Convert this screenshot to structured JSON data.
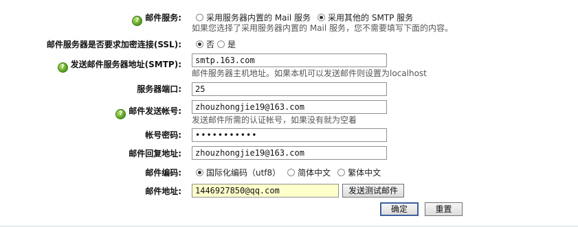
{
  "mail_service": {
    "label": "邮件服务:",
    "options": [
      "采用服务器内置的 Mail 服务",
      "采用其他的 SMTP 服务"
    ],
    "hint": "如果您选择了采用服务器内置的 Mail 服务，您不需要填写下面的内容。"
  },
  "ssl": {
    "label": "邮件服务器是否要求加密连接(SSL):",
    "options": [
      "否",
      "是"
    ]
  },
  "smtp_host": {
    "label": "发送邮件服务器地址(SMTP):",
    "value": "smtp.163.com",
    "hint": "邮件服务器主机地址。如果本机可以发送邮件则设置为localhost"
  },
  "port": {
    "label": "服务器端口:",
    "value": "25"
  },
  "account": {
    "label": "邮件发送帐号:",
    "value": "zhouzhongjie19@163.com",
    "hint": "发送邮件所需的认证帐号，如果没有就为空着"
  },
  "password": {
    "label": "帐号密码:",
    "value": "•••••••••••"
  },
  "reply_address": {
    "label": "邮件回复地址:",
    "value": "zhouzhongjie19@163.com"
  },
  "encoding": {
    "label": "邮件编码:",
    "options": [
      "国际化编码（utf8）",
      "简体中文",
      "繁体中文"
    ]
  },
  "mail_address": {
    "label": "邮件地址:",
    "value": "1446927850@qq.com",
    "test_button": "发送测试邮件"
  },
  "actions": {
    "confirm": "确定",
    "reset": "重置"
  },
  "icons": {
    "help": "help-icon"
  },
  "colors": {
    "help_icon": "#4f9a1e",
    "highlight_input": "#ffffcc",
    "primary_border": "#3a5f9c"
  }
}
